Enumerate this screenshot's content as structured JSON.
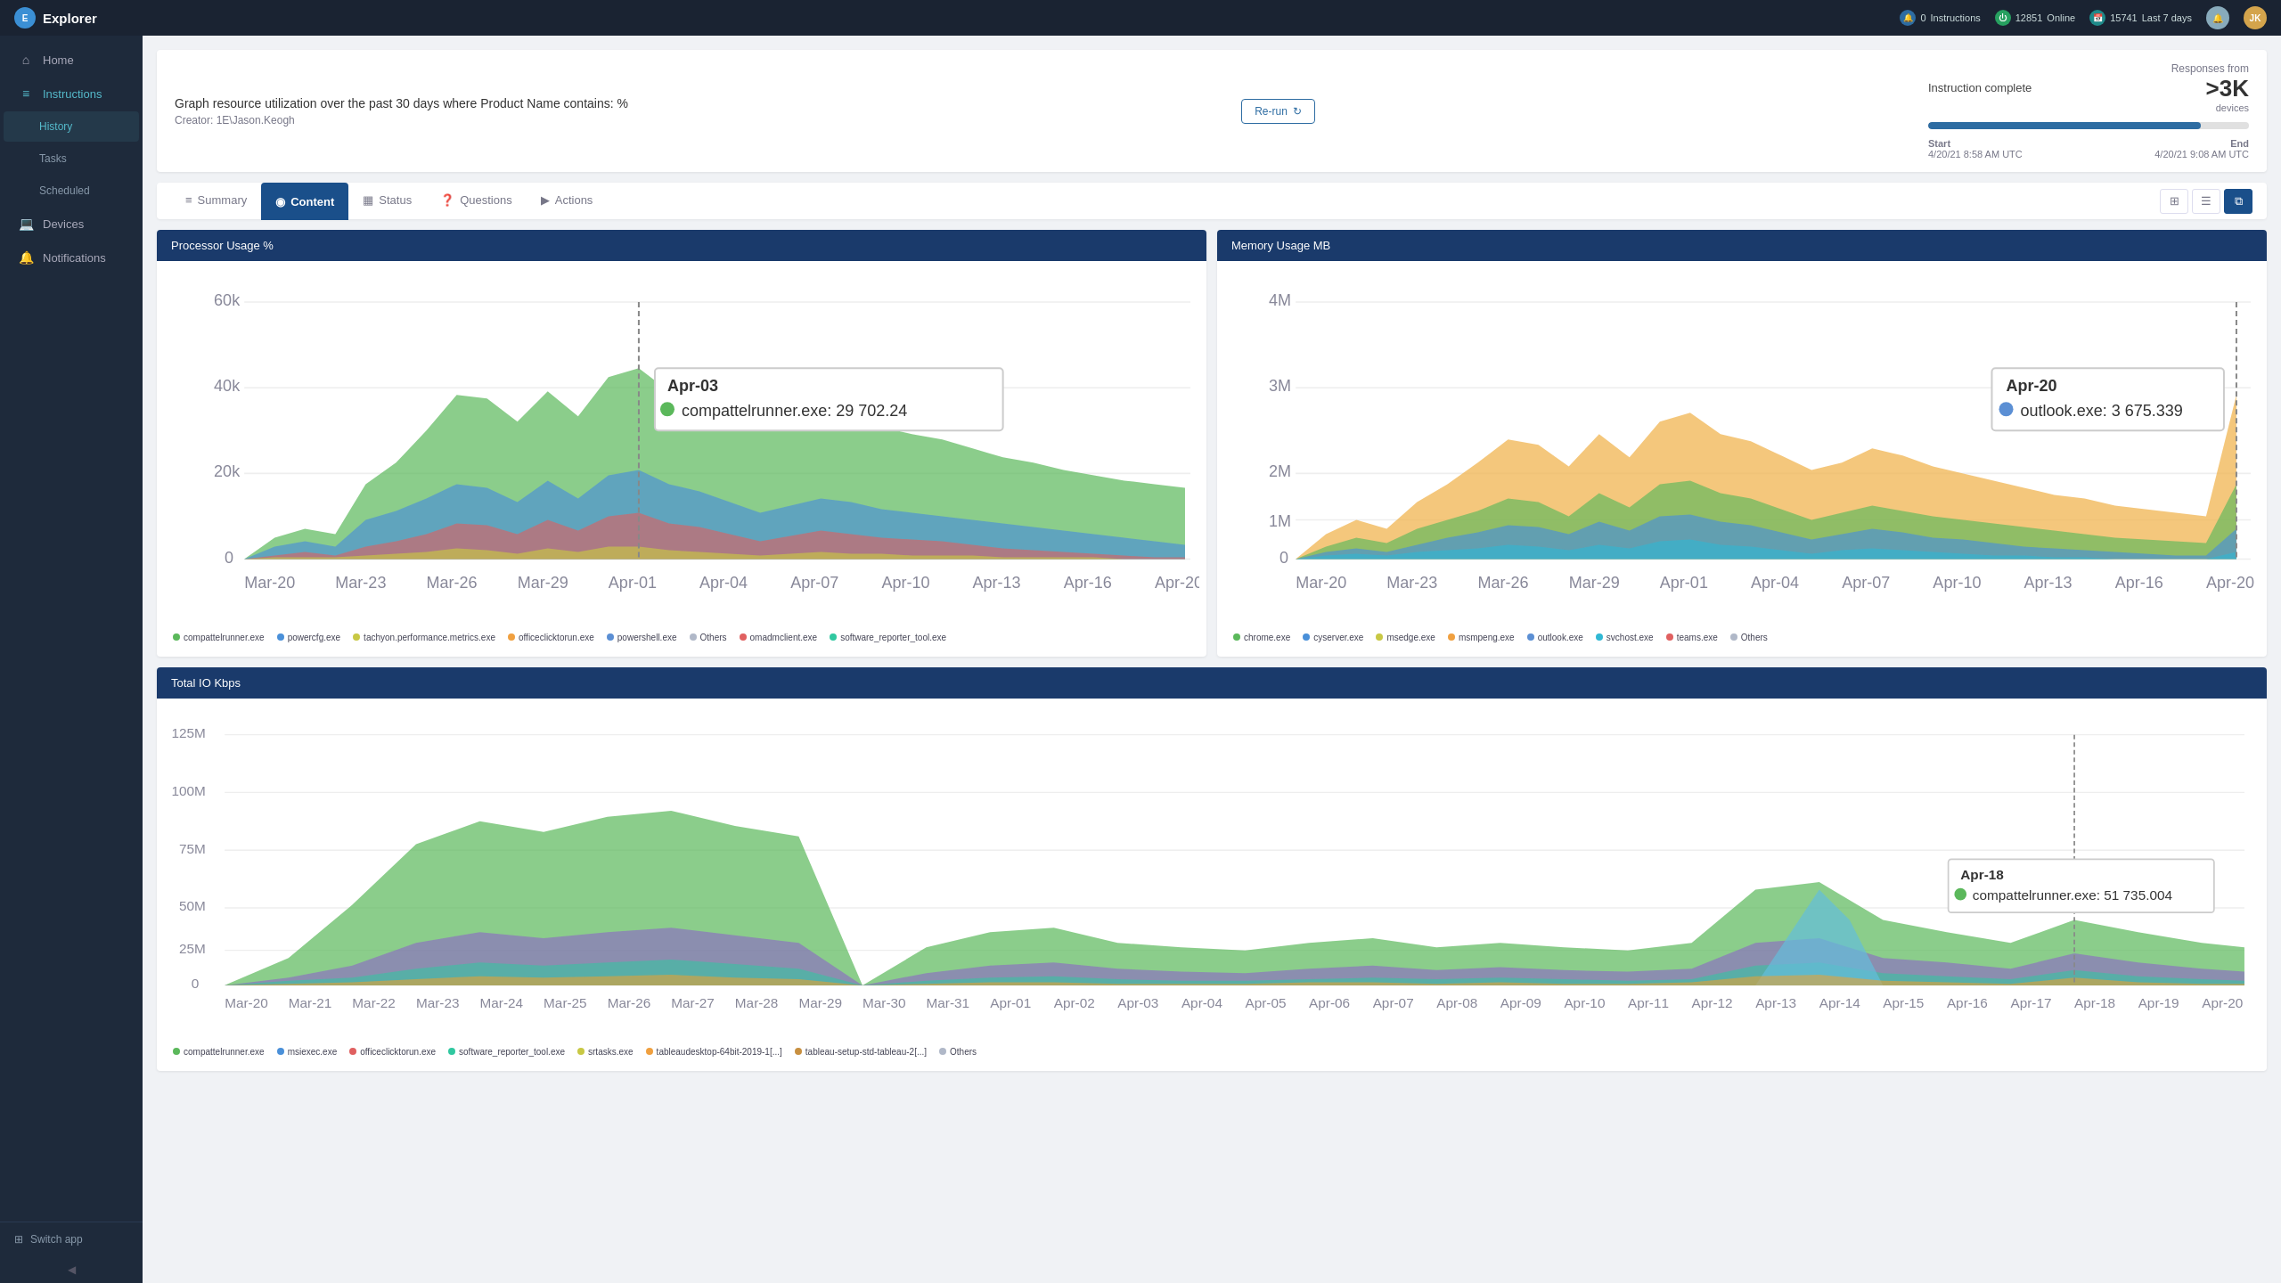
{
  "topnav": {
    "brand": "Explorer",
    "badges": [
      {
        "icon": "🔔",
        "label": "Instructions",
        "color": "badge-blue",
        "value": "0"
      },
      {
        "icon": "●",
        "label": "Online",
        "color": "badge-green",
        "value": "12851"
      },
      {
        "icon": "📅",
        "label": "Last 7 days",
        "color": "badge-teal",
        "value": "15741"
      }
    ],
    "avatar_initials": "JK"
  },
  "sidebar": {
    "items": [
      {
        "id": "home",
        "label": "Home",
        "icon": "⌂",
        "active": false
      },
      {
        "id": "instructions",
        "label": "Instructions",
        "icon": "≡",
        "active": true
      },
      {
        "id": "history",
        "label": "History",
        "sub": true
      },
      {
        "id": "tasks",
        "label": "Tasks",
        "sub": true
      },
      {
        "id": "scheduled",
        "label": "Scheduled",
        "sub": true
      },
      {
        "id": "devices",
        "label": "Devices",
        "icon": "💻",
        "active": false
      },
      {
        "id": "notifications",
        "label": "Notifications",
        "icon": "🔔",
        "active": false
      }
    ],
    "switch_app": "Switch app"
  },
  "header": {
    "description": "Graph resource utilization over the past 30 days where Product Name contains: %",
    "creator": "Creator: 1E\\Jason.Keogh",
    "rerun_label": "Re-run"
  },
  "instruction_panel": {
    "label": "Instruction complete",
    "progress": 85,
    "start_label": "Start",
    "end_label": "End",
    "start_date": "4/20/21 8:58 AM UTC",
    "end_date": "4/20/21 9:08 AM UTC",
    "responses_label": "Responses from",
    "responses_count": ">3K",
    "responses_sub": "devices"
  },
  "tabs": [
    {
      "id": "summary",
      "label": "Summary",
      "icon": "≡",
      "active": false
    },
    {
      "id": "content",
      "label": "Content",
      "icon": "◉",
      "active": true
    },
    {
      "id": "status",
      "label": "Status",
      "icon": "▦",
      "active": false
    },
    {
      "id": "questions",
      "label": "Questions",
      "icon": "❓",
      "active": false
    },
    {
      "id": "actions",
      "label": "Actions",
      "icon": "▶",
      "active": false
    }
  ],
  "charts": {
    "processor": {
      "title": "Processor Usage %",
      "tooltip": {
        "date": "Apr-03",
        "item": "compattelrunner.exe:",
        "value": "29 702.239999999878"
      },
      "legend": [
        {
          "label": "compattelrunner.exe",
          "color": "#5bb85b"
        },
        {
          "label": "powercfg.exe",
          "color": "#4a90d9"
        },
        {
          "label": "tachyon.performance.metrics.exe",
          "color": "#c8c844"
        },
        {
          "label": "officeclicktorun.exe",
          "color": "#f0a040"
        },
        {
          "label": "powershell.exe",
          "color": "#5b8fd4"
        },
        {
          "label": "Others",
          "color": "#b0b8c8"
        },
        {
          "label": "omadmclient.exe",
          "color": "#e06060"
        },
        {
          "label": "software_reporter_tool.exe",
          "color": "#30c8a0"
        }
      ]
    },
    "memory": {
      "title": "Memory Usage MB",
      "tooltip": {
        "date": "Apr-20",
        "item": "outlook.exe:",
        "value": "3 675.339"
      },
      "legend": [
        {
          "label": "chrome.exe",
          "color": "#5bb85b"
        },
        {
          "label": "cyserver.exe",
          "color": "#4a90d9"
        },
        {
          "label": "msedge.exe",
          "color": "#c8c844"
        },
        {
          "label": "msmpeng.exe",
          "color": "#f0a040"
        },
        {
          "label": "outlook.exe",
          "color": "#5b8fd4"
        },
        {
          "label": "svchost.exe",
          "color": "#30b8d4"
        },
        {
          "label": "teams.exe",
          "color": "#e06060"
        },
        {
          "label": "Others",
          "color": "#b0b8c8"
        }
      ]
    },
    "total_io": {
      "title": "Total IO Kbps",
      "tooltip": {
        "date": "Apr-18",
        "item": "compattelrunner.exe:",
        "value": "51 735.004"
      },
      "legend": [
        {
          "label": "compattelrunner.exe",
          "color": "#5bb85b"
        },
        {
          "label": "msiexec.exe",
          "color": "#4a90d9"
        },
        {
          "label": "officeclicktorun.exe",
          "color": "#e06060"
        },
        {
          "label": "software_reporter_tool.exe",
          "color": "#30c8a0"
        },
        {
          "label": "srtasks.exe",
          "color": "#c8c844"
        },
        {
          "label": "tableaudesktop-64bit-2019-1[...]",
          "color": "#f0a040"
        },
        {
          "label": "tableau-setup-std-tableau-2[...]",
          "color": "#c89040"
        },
        {
          "label": "Others",
          "color": "#b0b8c8"
        }
      ]
    }
  },
  "x_labels_short": [
    "Mar-20",
    "Mar-21",
    "Mar-22",
    "Mar-23",
    "Mar-24",
    "Mar-25",
    "Mar-26",
    "Mar-27",
    "Mar-28",
    "Mar-29",
    "Mar-30",
    "Mar-31",
    "Apr-01",
    "Apr-02",
    "Apr-03",
    "Apr-04",
    "Apr-05",
    "Apr-06",
    "Apr-07",
    "Apr-08",
    "Apr-09",
    "Apr-10",
    "Apr-11",
    "Apr-12",
    "Apr-13",
    "Apr-14",
    "Apr-15",
    "Apr-16",
    "Apr-17",
    "Apr-18",
    "Apr-19",
    "Apr-20"
  ]
}
